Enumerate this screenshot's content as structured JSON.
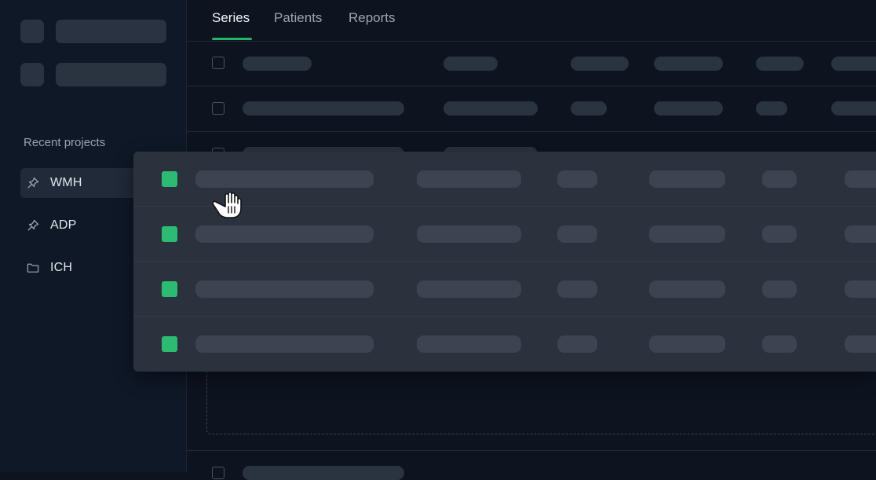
{
  "sidebar": {
    "recent_title": "Recent projects",
    "projects": [
      {
        "label": "WMH",
        "icon": "pin-icon",
        "active": true
      },
      {
        "label": "ADP",
        "icon": "pin-icon",
        "active": false
      },
      {
        "label": "ICH",
        "icon": "folder-icon",
        "active": false
      }
    ]
  },
  "tabs": [
    {
      "label": "Series",
      "active": true
    },
    {
      "label": "Patients",
      "active": false
    },
    {
      "label": "Reports",
      "active": false
    }
  ],
  "colors": {
    "accent": "#26b36a",
    "selected_marker": "#2dbb74",
    "background": "#0d1420",
    "sidebar": "#0f1827",
    "drag_overlay": "#2a323d"
  },
  "drag": {
    "cursor_icon": "grab-hand-icon",
    "dragged_row_count": 4
  }
}
